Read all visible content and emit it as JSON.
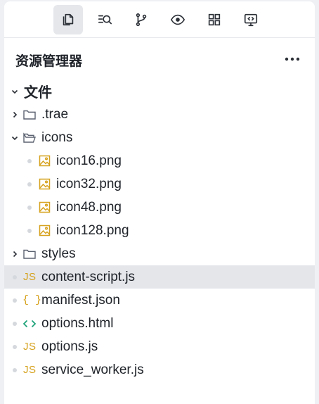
{
  "toolbar": {
    "buttons": [
      {
        "icon": "files-icon",
        "active": true
      },
      {
        "icon": "search-icon",
        "active": false
      },
      {
        "icon": "source-control-icon",
        "active": false
      },
      {
        "icon": "preview-icon",
        "active": false
      },
      {
        "icon": "extensions-icon",
        "active": false
      },
      {
        "icon": "remote-display-icon",
        "active": false
      }
    ]
  },
  "explorer": {
    "title": "资源管理器",
    "more_label": "···"
  },
  "tree": {
    "root": {
      "label": "文件",
      "expanded": true
    },
    "items": [
      {
        "label": ".trae",
        "type": "folder",
        "expanded": false
      },
      {
        "label": "icons",
        "type": "folder",
        "expanded": true
      },
      {
        "label": "icon16.png",
        "type": "image"
      },
      {
        "label": "icon32.png",
        "type": "image"
      },
      {
        "label": "icon48.png",
        "type": "image"
      },
      {
        "label": "icon128.png",
        "type": "image"
      },
      {
        "label": "styles",
        "type": "folder",
        "expanded": false
      },
      {
        "label": "content-script.js",
        "type": "js",
        "selected": true
      },
      {
        "label": "manifest.json",
        "type": "json"
      },
      {
        "label": "options.html",
        "type": "html"
      },
      {
        "label": "options.js",
        "type": "js"
      },
      {
        "label": "service_worker.js",
        "type": "js"
      }
    ],
    "icon_text": {
      "js": "JS",
      "json": "{ }",
      "html": "< >"
    }
  },
  "colors": {
    "accent_yellow": "#d6a21e",
    "html_green": "#1fa37a",
    "selected_bg": "#e4e6ea"
  }
}
